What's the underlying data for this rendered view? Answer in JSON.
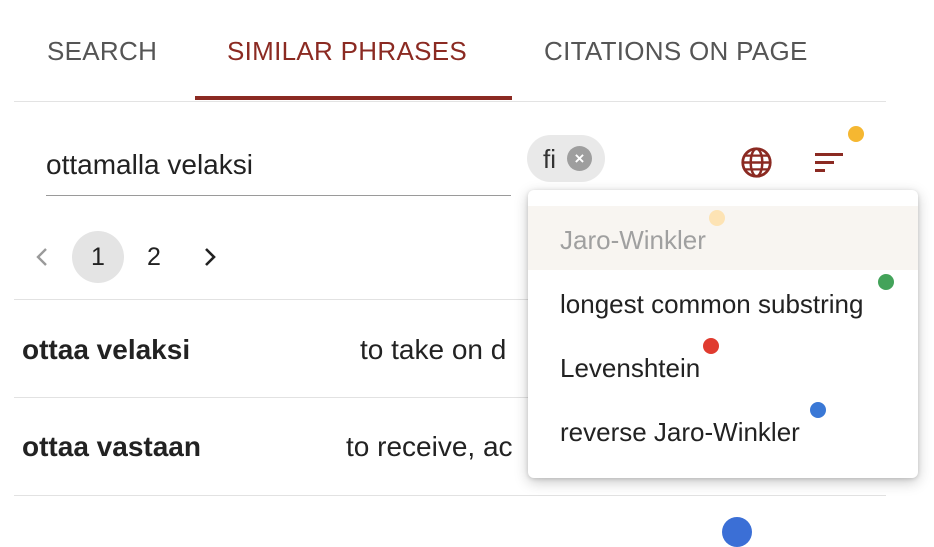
{
  "tabs": [
    {
      "label": "SEARCH"
    },
    {
      "label": "SIMILAR PHRASES"
    },
    {
      "label": "CITATIONS ON PAGE"
    }
  ],
  "active_tab": "SIMILAR PHRASES",
  "search": {
    "value": "ottamalla velaksi"
  },
  "language_chip": {
    "label": "fi"
  },
  "icons": {
    "globe": "globe-icon",
    "sort": "sort-icon",
    "close": "close-circle-icon"
  },
  "pagination": {
    "pages": [
      "1",
      "2"
    ],
    "current": "1"
  },
  "results": [
    {
      "phrase": "ottaa velaksi",
      "translation": "to take on d"
    },
    {
      "phrase": "ottaa vastaan",
      "translation": "to receive, ac"
    }
  ],
  "sort_menu": {
    "items": [
      {
        "label": "Jaro-Winkler",
        "dot_color": "#fde3b4",
        "selected": true
      },
      {
        "label": "longest common substring",
        "dot_color": "#43a35a"
      },
      {
        "label": "Levenshtein",
        "dot_color": "#e03b2f"
      },
      {
        "label": "reverse Jaro-Winkler",
        "dot_color": "#3a78d6"
      }
    ]
  },
  "colors": {
    "accent": "#8b2a22",
    "sort_badge": "#f5b731",
    "bottom_dot": "#3b6fd6"
  }
}
